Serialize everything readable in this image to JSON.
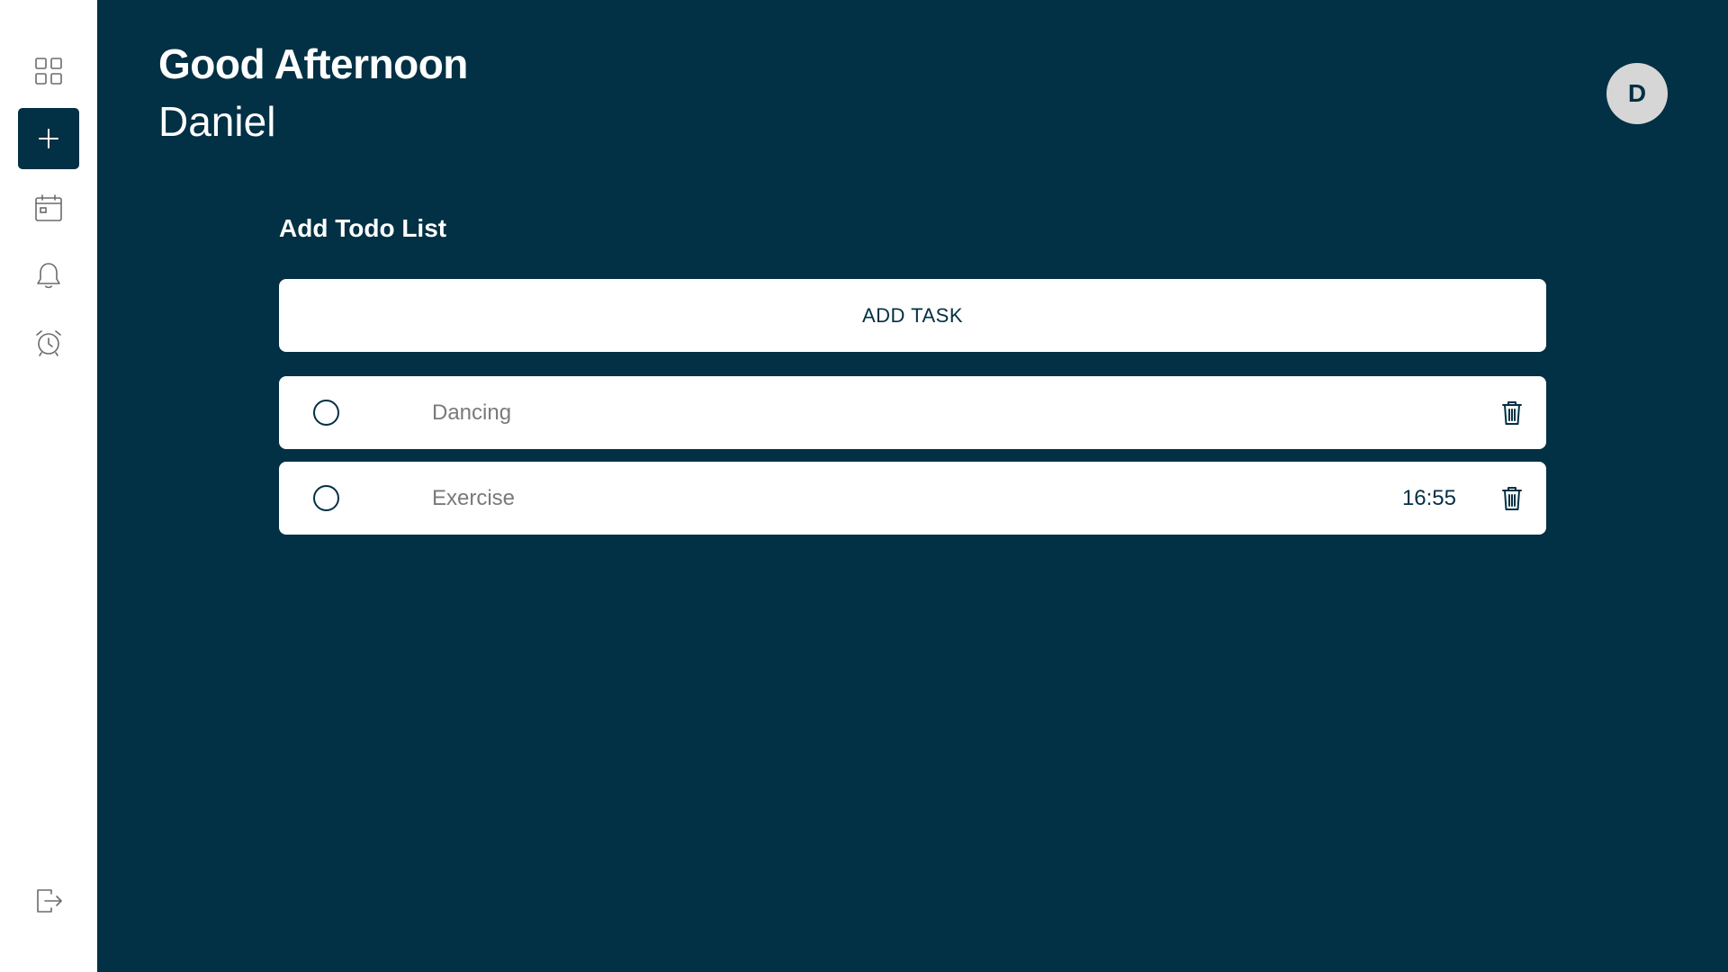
{
  "sidebar": {
    "items": [
      {
        "name": "dashboard",
        "icon": "grid-icon"
      },
      {
        "name": "add",
        "icon": "plus-icon",
        "active": true
      },
      {
        "name": "calendar",
        "icon": "calendar-icon"
      },
      {
        "name": "notifications",
        "icon": "bell-icon"
      },
      {
        "name": "alarm",
        "icon": "alarm-clock-icon"
      }
    ],
    "logout_icon": "logout-icon"
  },
  "header": {
    "greeting": "Good Afternoon",
    "username": "Daniel",
    "avatar_initial": "D"
  },
  "todo": {
    "title": "Add Todo List",
    "add_button_label": "ADD TASK",
    "tasks": [
      {
        "label": "Dancing",
        "time": ""
      },
      {
        "label": "Exercise",
        "time": "16:55"
      }
    ]
  },
  "colors": {
    "background": "#023044",
    "sidebar": "#ffffff",
    "card": "#ffffff",
    "avatar": "#d6d6d6",
    "muted_text": "#7a7a7a"
  }
}
